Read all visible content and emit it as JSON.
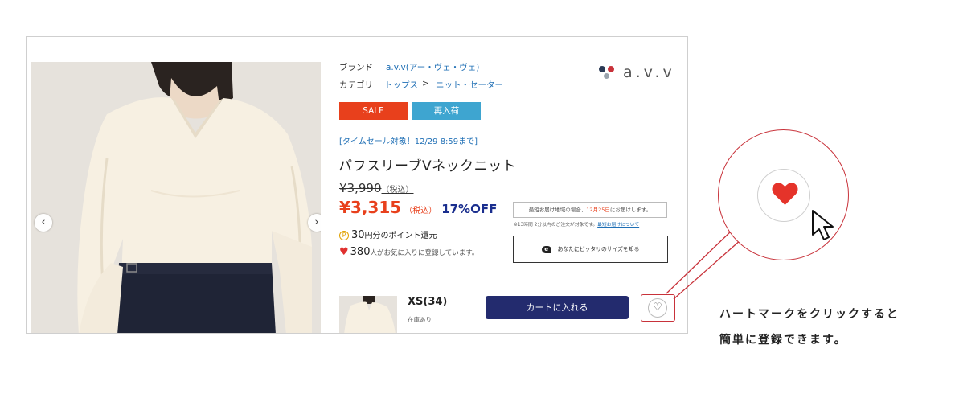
{
  "product": {
    "brand_label": "ブランド",
    "brand_value": "a.v.v(アー・ヴェ・ヴェ)",
    "category_label": "カテゴリ",
    "category_crumbs": [
      "トップス",
      ">",
      "ニット・セーター"
    ],
    "logo_text": "a.v.v",
    "tags": {
      "sale": "SALE",
      "restock": "再入荷"
    },
    "promo": "[タイムセール対象！12/29 8:59まで]",
    "title": "パフスリーブVネックニット",
    "old_price": "¥3,990",
    "old_tax": "（税込）",
    "new_price": "¥3,315",
    "new_tax": "（税込）",
    "discount": "17%OFF",
    "points_icon": "P",
    "points_value": "30",
    "points_text": "円分のポイント還元",
    "favorites_count": "380",
    "favorites_text": "人がお気に入りに登録しています。",
    "delivery_prefix": "最短お届け地域の場合、",
    "delivery_date": "12月25日",
    "delivery_suffix": "にお届けします。",
    "delivery_note": "※13時間 2分以内のご注文が対象です。",
    "delivery_note_link": "最短お届けについて",
    "size_fit_button": "あなたにピッタリのサイズを知る",
    "size_fit_icon": "e",
    "size_name": "XS(34)",
    "stock_status": "在庫あり",
    "cart_button": "カートに入れる",
    "prev_arrow": "‹",
    "next_arrow": "›",
    "fav_icon": "♡"
  },
  "callout": {
    "caption_line1": "ハートマークをクリックすると",
    "caption_line2": "簡単に登録できます。"
  },
  "colors": {
    "sale": "#e8401c",
    "restock": "#3ea5d0",
    "cart": "#232b6e",
    "accent_red": "#c8323a",
    "heart": "#e5332a",
    "link": "#1f6fb5"
  }
}
